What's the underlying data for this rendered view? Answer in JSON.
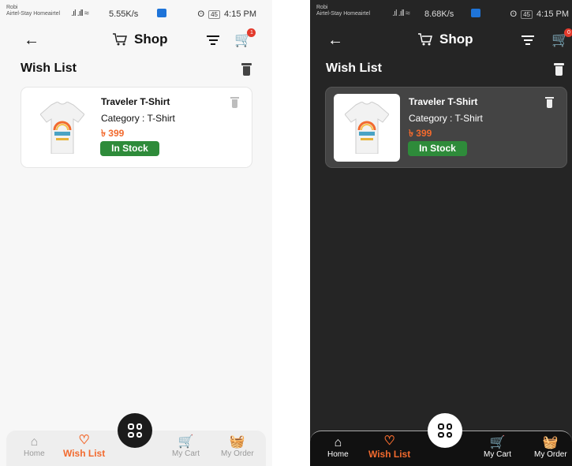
{
  "light": {
    "status": {
      "carrier1": "Robi",
      "carrier2": "Airtel-Stay Homeairtel",
      "speed": "5.55K/s",
      "battery": "45",
      "time": "4:15 PM"
    },
    "appbar": {
      "title": "Shop",
      "cart_count": "1"
    },
    "wishlist": {
      "title": "Wish List"
    },
    "item": {
      "name": "Traveler T-Shirt",
      "category": "Category : T-Shirt",
      "price": "৳ 399",
      "stock": "In Stock"
    },
    "nav": {
      "home": "Home",
      "wishlist": "Wish List",
      "cart": "My Cart",
      "order": "My Order"
    }
  },
  "dark": {
    "status": {
      "carrier1": "Robi",
      "carrier2": "Airtel-Stay Homeairtel",
      "speed": "8.68K/s",
      "battery": "45",
      "time": "4:15 PM"
    },
    "appbar": {
      "title": "Shop",
      "cart_count": "0"
    },
    "wishlist": {
      "title": "Wish List"
    },
    "item": {
      "name": "Traveler T-Shirt",
      "category": "Category : T-Shirt",
      "price": "৳ 399",
      "stock": "In Stock"
    },
    "nav": {
      "home": "Home",
      "wishlist": "Wish List",
      "cart": "My Cart",
      "order": "My Order"
    }
  },
  "icons": {
    "back": "arrow-left-icon",
    "cart": "cart-icon",
    "filter": "filter-icon",
    "trash": "trash-icon",
    "home": "home-icon",
    "heart": "heart-icon",
    "basket": "basket-icon",
    "grid": "grid-menu-icon"
  },
  "colors": {
    "accent": "#f26a2e",
    "stock_green": "#2e8b3a",
    "badge_red": "#e33a2c"
  }
}
